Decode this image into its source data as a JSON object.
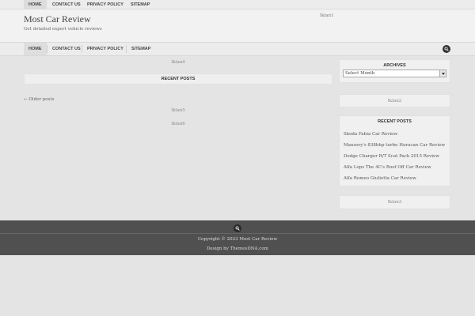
{
  "top_nav": {
    "items": [
      {
        "label": "HOME",
        "active": true
      },
      {
        "label": "CONTACT US",
        "active": false
      },
      {
        "label": "PRIVACY POLICY",
        "active": false
      },
      {
        "label": "SITEMAP",
        "active": false
      }
    ]
  },
  "header": {
    "site_title": "Most Car Review",
    "tagline": "Get detailed expert vehicle reviews",
    "ad_label": "Iklan1"
  },
  "main_nav": {
    "items": [
      {
        "label": "HOME",
        "active": true
      },
      {
        "label": "CONTACT US",
        "active": false
      },
      {
        "label": "PRIVACY POLICY",
        "active": false
      },
      {
        "label": "SITEMAP",
        "active": false
      }
    ],
    "search_icon": "search-icon"
  },
  "content": {
    "ad_top": "Iklan4",
    "recent_posts_title": "RECENT POSTS",
    "older_posts": "← Older posts",
    "ad_middle": "Iklan5",
    "ad_bottom": "Iklan6"
  },
  "sidebar": {
    "archives_title": "ARCHIVES",
    "archives_select": "Select Month",
    "ad_2": "Iklan2",
    "recent_posts_title": "RECENT POSTS",
    "recent_posts": [
      "Skoda Fabia Car Review",
      "Mansory's 838bhp turbo Huracan Car Review",
      "Dodge Charger R/T Scat Pack 2015 Review",
      "Alfa Lops The 4C's Roof Off Car Review",
      "Alfa Romeo Giulietta Car Review"
    ],
    "ad_3": "Iklan3"
  },
  "footer": {
    "search_icon": "search-icon",
    "copyright": "Copyright © 2023 Most Car Review",
    "design_credit": "Design by ThemesDNA.com"
  },
  "colors": {
    "background": "#e4e4e4",
    "footer": "#505050",
    "search_button": "#333333"
  }
}
